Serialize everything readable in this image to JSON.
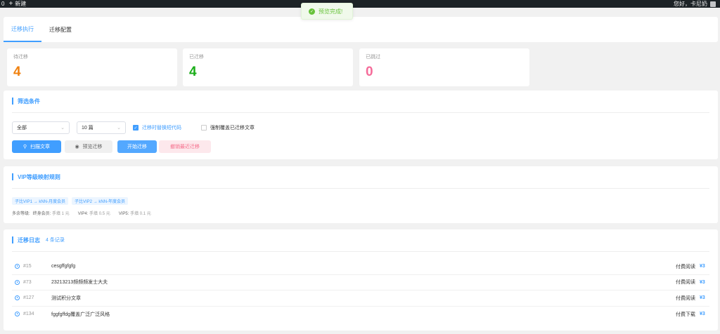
{
  "topbar": {
    "left_num": "0",
    "new_label": "新建",
    "greeting": "您好，卡尼奶"
  },
  "toast": {
    "message": "预览完成!"
  },
  "tabs": [
    {
      "label": "迁移执行",
      "active": true
    },
    {
      "label": "迁移配置",
      "active": false
    }
  ],
  "stats": [
    {
      "label": "待迁移",
      "value": "4",
      "color": "#f0810f"
    },
    {
      "label": "已迁移",
      "value": "4",
      "color": "#1aad19"
    },
    {
      "label": "已跳过",
      "value": "0",
      "color": "#f56c9a"
    }
  ],
  "filter": {
    "title": "筛选条件",
    "scope_select": "全部",
    "count_select": "10 篇",
    "replace_shortcode": {
      "label": "迁移时替换短代码",
      "checked": true
    },
    "force_overwrite": {
      "label": "强制覆盖已迁移文章",
      "checked": false
    },
    "buttons": {
      "scan": "扫描文章",
      "preview": "预览迁移",
      "start": "开始迁移",
      "undo": "撤销最近迁移"
    }
  },
  "vip": {
    "title": "VIP等级映射规则",
    "tags": [
      "子比VIP1 → kNN-月度会员",
      "子比VIP2 → kNN-年度会员"
    ],
    "extra_prefix": "多余等级:",
    "extras": [
      {
        "name": "终身会员:",
        "value": "手填 1 元"
      },
      {
        "name": "VIP4:",
        "value": "手填 0.5 元"
      },
      {
        "name": "VIP5:",
        "value": "手填 0.1 元"
      }
    ]
  },
  "log": {
    "title": "迁移日志",
    "count": "4 条记录",
    "rows": [
      {
        "id": "#15",
        "title": "cesgffgfgfg",
        "type": "付费阅读",
        "price": "¥3"
      },
      {
        "id": "#73",
        "title": "23213213频频频发士大夫",
        "type": "付费阅读",
        "price": "¥3"
      },
      {
        "id": "#127",
        "title": "测试积分文章",
        "type": "付费阅读",
        "price": "¥3"
      },
      {
        "id": "#134",
        "title": "fggfgffdg覆盖广泛广泛风格",
        "type": "付费下载",
        "price": "¥3"
      }
    ]
  },
  "colors": {
    "accent": "#409eff",
    "success": "#67c23a"
  }
}
